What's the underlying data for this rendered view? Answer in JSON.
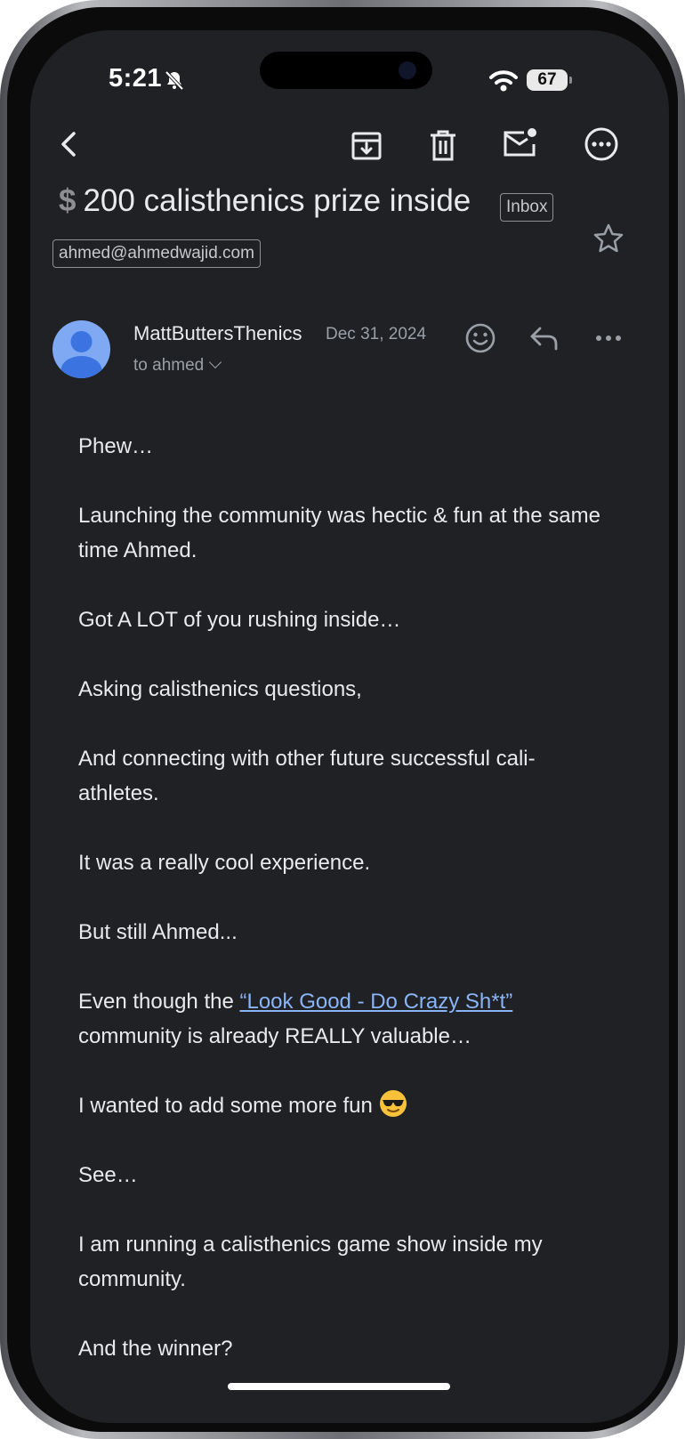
{
  "status_bar": {
    "time": "5:21",
    "battery": "67"
  },
  "email": {
    "subject_icon": "$",
    "subject": "200 calisthenics prize inside",
    "folder_badge": "Inbox",
    "label": "ahmed@ahmedwajid.com",
    "sender": "MattButtersThenics",
    "date": "Dec 31, 2024",
    "recipient": "to ahmed",
    "body": {
      "p1": "Phew…",
      "p2": "Launching the community was hectic & fun at the same time Ahmed.",
      "p3": "Got A LOT of you rushing inside…",
      "p4": "Asking calisthenics questions,",
      "p5": "And connecting with other future successful cali-athletes.",
      "p6": "It was a really cool experience.",
      "p7": "But still Ahmed...",
      "p8_before": "Even though the ",
      "p8_link": "“Look Good - Do Crazy Sh*t”",
      "p8_after": " community is already REALLY valuable…",
      "p9": "I wanted to add some more fun ",
      "p10": "See…",
      "p11": "I am running a calisthenics game show inside my community.",
      "p12": "And the winner?"
    }
  },
  "icons": [
    "back-arrow-icon",
    "archive-icon",
    "delete-icon",
    "mark-unread-icon",
    "more-options-icon",
    "star-icon",
    "avatar-icon",
    "emoji-reaction-icon",
    "reply-icon",
    "more-horizontal-icon",
    "bell-slash-icon",
    "wifi-icon",
    "sunglasses-emoji-icon"
  ],
  "colors": {
    "background": "#202124",
    "text": "#e8eaed",
    "secondary_text": "#9aa0a6",
    "link": "#8ab4f8",
    "avatar": "#7fa9f3"
  }
}
